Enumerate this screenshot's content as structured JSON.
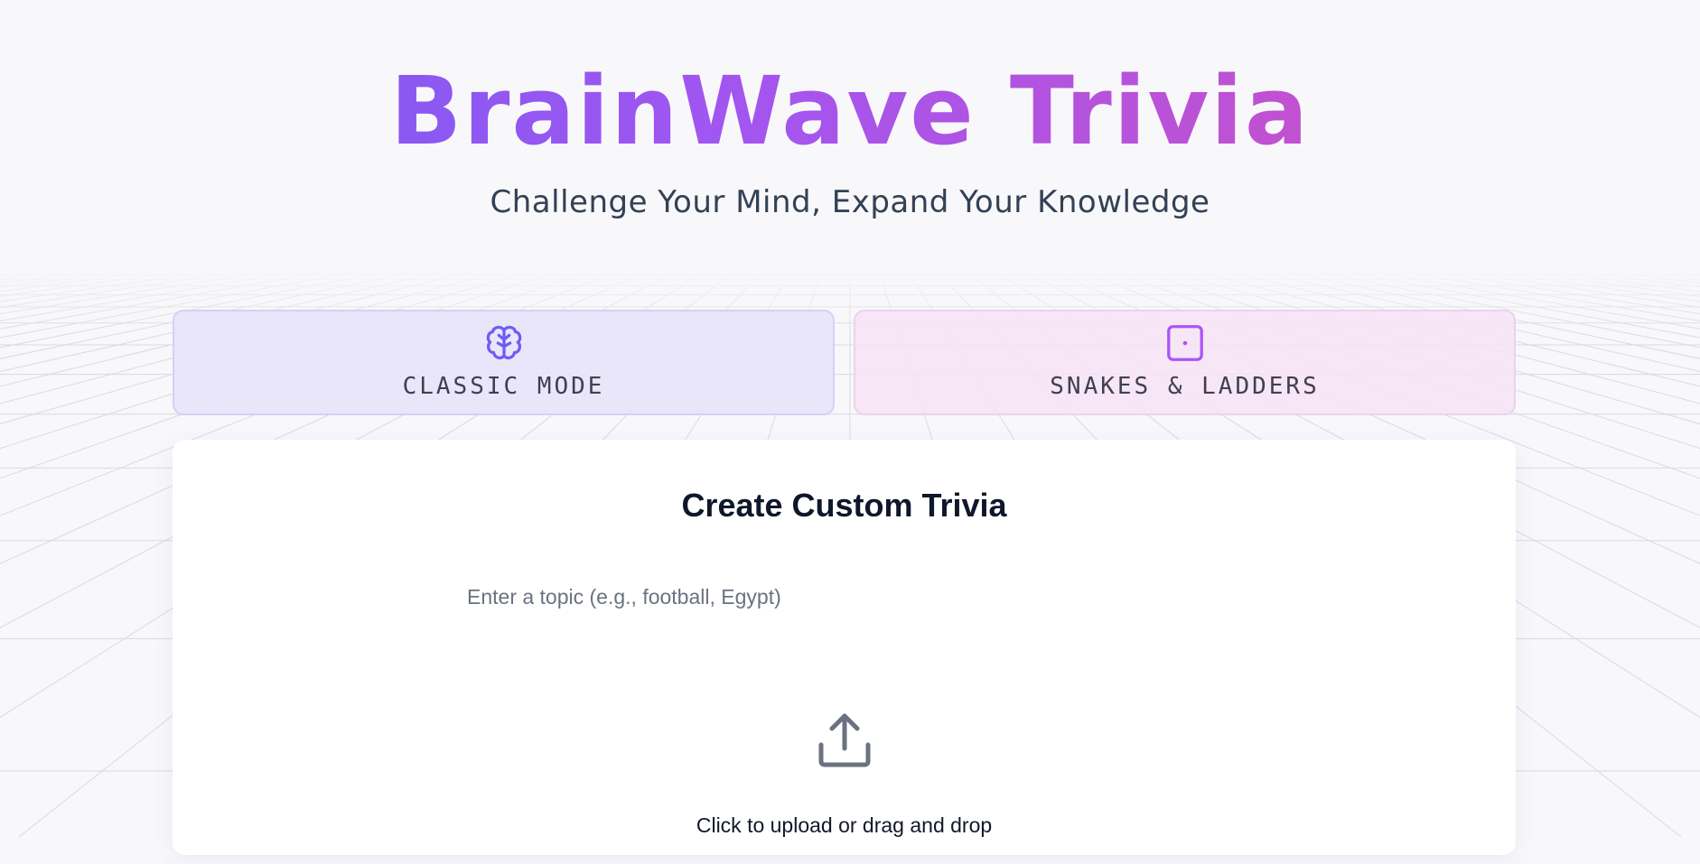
{
  "header": {
    "title": "BrainWave Trivia",
    "subtitle": "Challenge Your Mind, Expand Your Knowledge"
  },
  "modes": [
    {
      "label": "CLASSIC MODE",
      "icon": "brain-icon",
      "accent": "#6f5cf6"
    },
    {
      "label": "SNAKES & LADDERS",
      "icon": "dice-icon",
      "accent": "#a855f7"
    }
  ],
  "custom_trivia": {
    "title": "Create Custom Trivia",
    "topic_placeholder": "Enter a topic (e.g., football, Egypt)",
    "topic_value": "",
    "upload_icon": "upload-icon",
    "upload_text": "Click to upload or drag and drop"
  },
  "colors": {
    "title_gradient_start": "#6f5cf6",
    "title_gradient_end": "#d64eb9",
    "subtitle": "#334155",
    "card_title": "#0f172a"
  }
}
